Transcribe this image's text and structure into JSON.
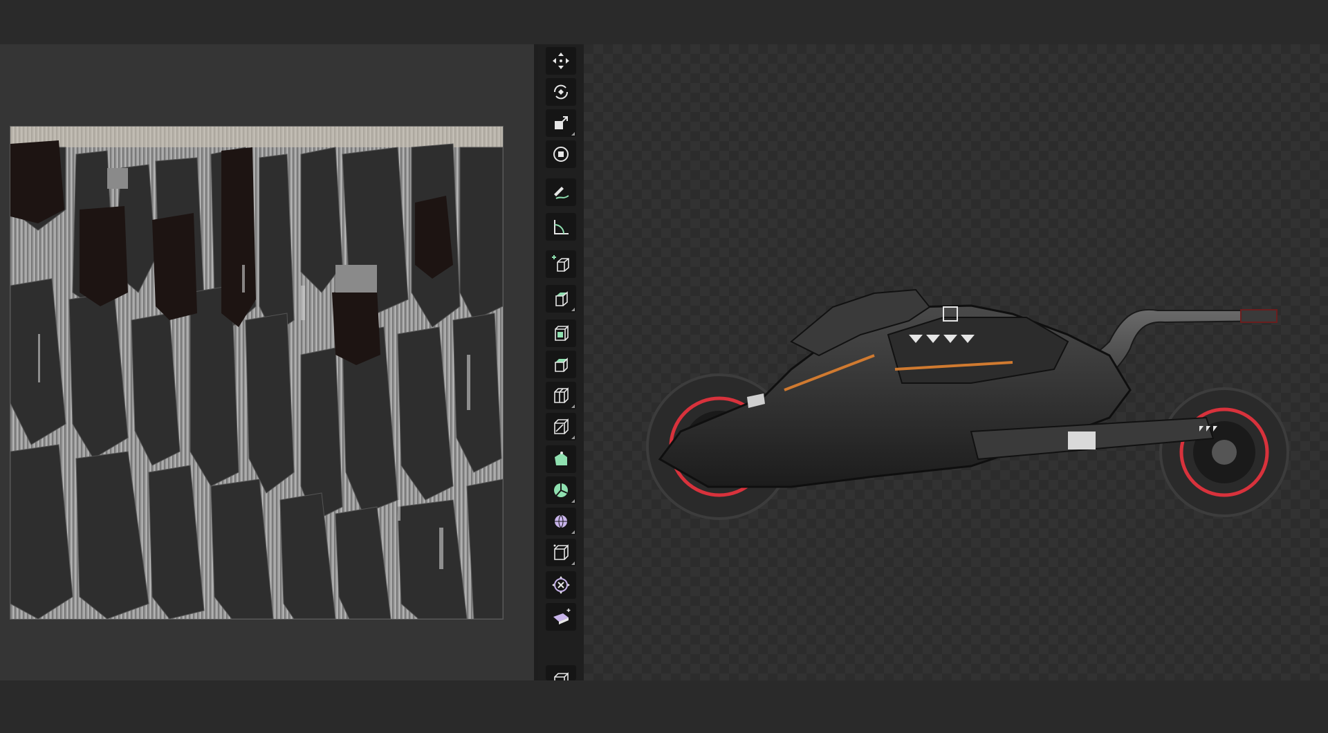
{
  "app": {
    "colors": {
      "background": "#2a2a2a",
      "panel": "#353535",
      "toolbar": "#1f1f1f",
      "tool_icon_white": "#e6e6e6",
      "tool_icon_green": "#8fe0b0",
      "tool_icon_purple": "#c8b4ea",
      "wheel_accent": "#d8323c",
      "bike_trim": "#d07a30"
    }
  },
  "uv_editor": {
    "texture": "uv-texture-atlas"
  },
  "toolbar": {
    "tools": [
      {
        "name": "move-tool",
        "icon": "move-arrows-icon"
      },
      {
        "name": "rotate-tool",
        "icon": "rotate-icon"
      },
      {
        "name": "scale-tool",
        "icon": "scale-icon"
      },
      {
        "name": "transform-tool",
        "icon": "transform-icon"
      },
      {
        "name": "annotate-tool",
        "icon": "pencil-curve-icon"
      },
      {
        "name": "measure-tool",
        "icon": "ruler-angle-icon"
      },
      {
        "name": "add-cube-tool",
        "icon": "add-cube-icon"
      },
      {
        "name": "extrude-region-tool",
        "icon": "extrude-cube-icon"
      },
      {
        "name": "inset-faces-tool",
        "icon": "inset-cube-icon"
      },
      {
        "name": "bevel-tool",
        "icon": "bevel-cube-icon"
      },
      {
        "name": "loop-cut-tool",
        "icon": "loop-cut-icon"
      },
      {
        "name": "knife-tool",
        "icon": "knife-cube-icon"
      },
      {
        "name": "poly-build-tool",
        "icon": "poly-build-icon"
      },
      {
        "name": "spin-tool",
        "icon": "spin-icon"
      },
      {
        "name": "smooth-tool",
        "icon": "smooth-sphere-icon"
      },
      {
        "name": "edge-slide-tool",
        "icon": "edge-slide-icon"
      },
      {
        "name": "shrink-fatten-tool",
        "icon": "shrink-fatten-icon"
      },
      {
        "name": "shear-tool",
        "icon": "shear-icon"
      },
      {
        "name": "rip-region-tool",
        "icon": "rip-region-icon"
      }
    ]
  },
  "viewport": {
    "model": "futuristic-motorcycle-model",
    "background": "transparency-checkerboard"
  }
}
